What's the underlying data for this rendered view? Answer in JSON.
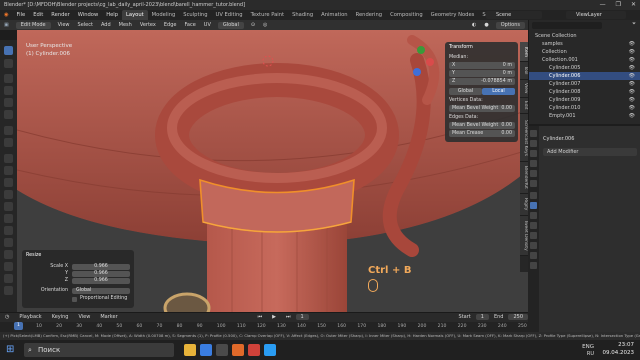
{
  "window": {
    "title": "Blender* [D:\\MFDOH\\Blender projects\\cg_lab_daily_april-2023\\blend\\barell_hammer_tutor.blend]",
    "controls": [
      "—",
      "❐",
      "✕"
    ]
  },
  "menubar": {
    "menus": [
      "File",
      "Edit",
      "Render",
      "Window",
      "Help"
    ],
    "workspaces": [
      "Layout",
      "Modeling",
      "Sculpting",
      "UV Editing",
      "Texture Paint",
      "Shading",
      "Animation",
      "Rendering",
      "Compositing",
      "Geometry Nodes",
      "Scripting"
    ],
    "active_workspace": "Layout",
    "scene": "Scene",
    "view_layer": "ViewLayer"
  },
  "viewport_header": {
    "mode": "Edit Mode",
    "menus": [
      "View",
      "Select",
      "Add",
      "Mesh",
      "Vertex",
      "Edge",
      "Face",
      "UV"
    ],
    "orientation": "Global",
    "options": "Options"
  },
  "viewport": {
    "view_name": "User Perspective",
    "object_name": "(1) Cylinder.006"
  },
  "npanel": {
    "section": "Transform",
    "median_label": "Median:",
    "x_label": "X",
    "x_value": "0 m",
    "y_label": "Y",
    "y_value": "0 m",
    "z_label": "Z",
    "z_value": "-0.078854 m",
    "global_label": "Global",
    "local_label": "Local",
    "vertices_data_label": "Vertices Data:",
    "mean_bevel_weight_label": "Mean Bevel Weight",
    "mean_bevel_weight_value": "0.00",
    "edges_data_label": "Edges Data:",
    "edge_bevel_label": "Mean Bevel Weight",
    "edge_bevel_value": "0.00",
    "mean_crease_label": "Mean Crease",
    "mean_crease_value": "0.00"
  },
  "vertical_tabs": [
    "Item",
    "Tool",
    "View",
    "Edit",
    "Screencast Keys",
    "BlenderKit",
    "Rigify",
    "Tweet Density"
  ],
  "operator_panel": {
    "title": "Resize",
    "scale_x_label": "Scale X",
    "scale_x_value": "0.966",
    "y_label": "Y",
    "y_value": "0.966",
    "z_label": "Z",
    "z_value": "0.966",
    "orientation_label": "Orientation",
    "orientation_value": "Global",
    "proportional_label": "Proportional Editing"
  },
  "key_hint": {
    "keys": "Ctrl + B"
  },
  "timeline": {
    "menus": [
      "Playback",
      "Keying",
      "View",
      "Marker"
    ],
    "current_frame": "1",
    "start_label": "Start",
    "start_value": "1",
    "end_label": "End",
    "end_value": "250",
    "ticks": [
      "1",
      "10",
      "20",
      "30",
      "40",
      "50",
      "60",
      "70",
      "80",
      "90",
      "100",
      "110",
      "120",
      "130",
      "140",
      "150",
      "160",
      "170",
      "180",
      "190",
      "200",
      "210",
      "220",
      "230",
      "240",
      "250"
    ]
  },
  "statusbar": {
    "text": "(+) Pick/Select(LMB) Confirm, Esc(RMB) Cancel, M: Mode (Offset), A: Width (0.00708 m), S: Segments (1), P: Profile (0.500), C: Clamp Overlap (OFF), V: Affect (Edges), O: Outer Miter (Sharp), I: Inner Miter (Sharp), H: Harden Normals (OFF), U: Mark Seam (OFF), K: Mark Sharp (OFF), Z: Profile Type (Superellipse), N: Intersection Type (Grid Fill)"
  },
  "outliner": {
    "items": [
      {
        "name": "Scene Collection",
        "indent": 0,
        "selected": false
      },
      {
        "name": "samples",
        "indent": 1,
        "selected": false
      },
      {
        "name": "Collection",
        "indent": 1,
        "selected": false
      },
      {
        "name": "Collection.001",
        "indent": 1,
        "selected": false
      },
      {
        "name": "Cylinder.005",
        "indent": 2,
        "selected": false
      },
      {
        "name": "Cylinder.006",
        "indent": 2,
        "selected": true
      },
      {
        "name": "Cylinder.007",
        "indent": 2,
        "selected": false
      },
      {
        "name": "Cylinder.008",
        "indent": 2,
        "selected": false
      },
      {
        "name": "Cylinder.009",
        "indent": 2,
        "selected": false
      },
      {
        "name": "Cylinder.010",
        "indent": 2,
        "selected": false
      },
      {
        "name": "Empty.001",
        "indent": 2,
        "selected": false
      }
    ]
  },
  "properties": {
    "object_name": "Cylinder.006",
    "add_modifier": "Add Modifier"
  },
  "taskbar": {
    "search_placeholder": "Поиск",
    "language": "ENG",
    "region": "RU",
    "time": "23:07",
    "date": "09.04.2023"
  },
  "colors": {
    "accent": "#4772b3",
    "model": "#b4564a",
    "hint": "#f2a95a"
  }
}
